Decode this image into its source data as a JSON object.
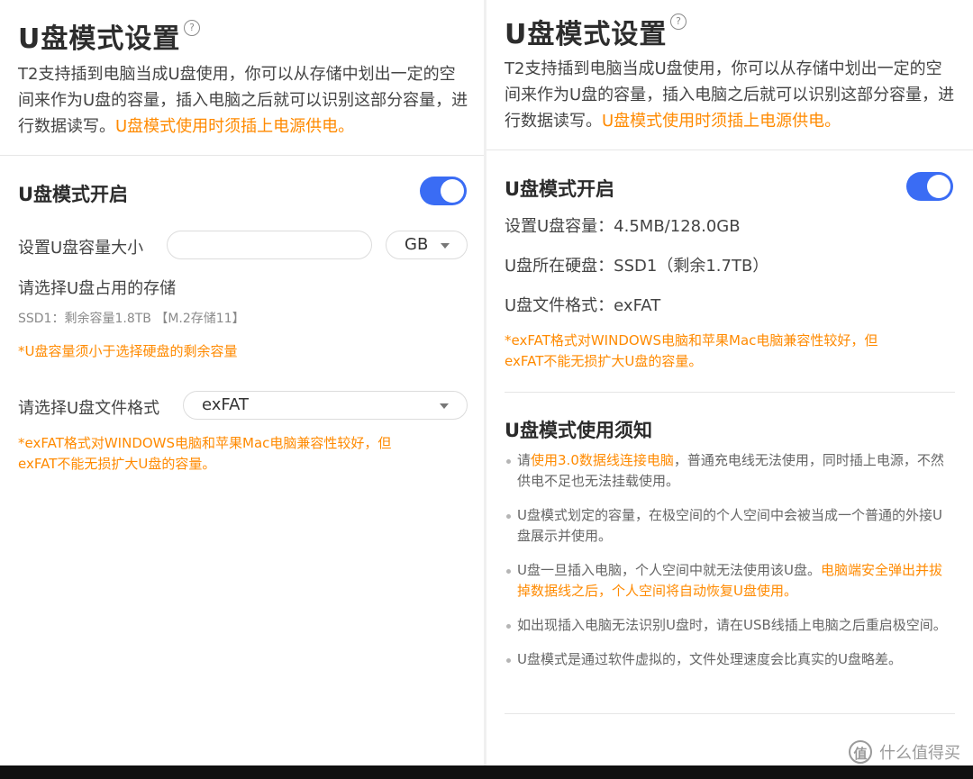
{
  "left": {
    "title": "U盘模式设置",
    "help_symbol": "?",
    "intro_text": "T2支持插到电脑当成U盘使用，你可以从存储中划出一定的空间来作为U盘的容量，插入电脑之后就可以识别这部分容量，进行数据读写。",
    "intro_highlight": "U盘模式使用时须插上电源供电。",
    "enable_label": "U盘模式开启",
    "toggle_on": true,
    "capacity_label": "设置U盘容量大小",
    "capacity_value": "",
    "capacity_unit": "GB",
    "storage_label": "请选择U盘占用的存储",
    "storage_option": "SSD1：剩余容量1.8TB 【M.2存储11】",
    "capacity_warning": "*U盘容量须小于选择硬盘的剩余容量",
    "format_label": "请选择U盘文件格式",
    "format_value": "exFAT",
    "format_warning_line1": "*exFAT格式对WINDOWS电脑和苹果Mac电脑兼容性较好，但",
    "format_warning_line2": "exFAT不能无损扩大U盘的容量。"
  },
  "right": {
    "title": "U盘模式设置",
    "help_symbol": "?",
    "intro_text": "T2支持插到电脑当成U盘使用，你可以从存储中划出一定的空间来作为U盘的容量，插入电脑之后就可以识别这部分容量，进行数据读写。",
    "intro_highlight": "U盘模式使用时须插上电源供电。",
    "enable_label": "U盘模式开启",
    "toggle_on": true,
    "capacity_info": "设置U盘容量：4.5MB/128.0GB",
    "disk_info": "U盘所在硬盘：SSD1（剩余1.7TB）",
    "format_info": "U盘文件格式：exFAT",
    "format_warning_line1": "*exFAT格式对WINDOWS电脑和苹果Mac电脑兼容性较好，但",
    "format_warning_line2": "exFAT不能无损扩大U盘的容量。",
    "notes_title": "U盘模式使用须知",
    "notes": [
      {
        "pre": "请",
        "highlight": "使用3.0数据线连接电脑",
        "post": "，普通充电线无法使用，同时插上电源，不然供电不足也无法挂载使用。"
      },
      {
        "pre": "U盘模式划定的容量，在极空间的个人空间中会被当成一个普通的外接U盘展示并使用。",
        "highlight": "",
        "post": ""
      },
      {
        "pre": "U盘一旦插入电脑，个人空间中就无法使用该U盘。",
        "highlight": "电脑端安全弹出并拔掉数据线之后，个人空间将自动恢复U盘使用。",
        "post": ""
      },
      {
        "pre": "如出现插入电脑无法识别U盘时，请在USB线插上电脑之后重启极空间。",
        "highlight": "",
        "post": ""
      },
      {
        "pre": "U盘模式是通过软件虚拟的，文件处理速度会比真实的U盘略差。",
        "highlight": "",
        "post": ""
      }
    ]
  },
  "watermark": {
    "logo_text": "值",
    "text": "什么值得买"
  },
  "colors": {
    "accent": "#3a6cf4",
    "warning": "#ff8a00"
  }
}
